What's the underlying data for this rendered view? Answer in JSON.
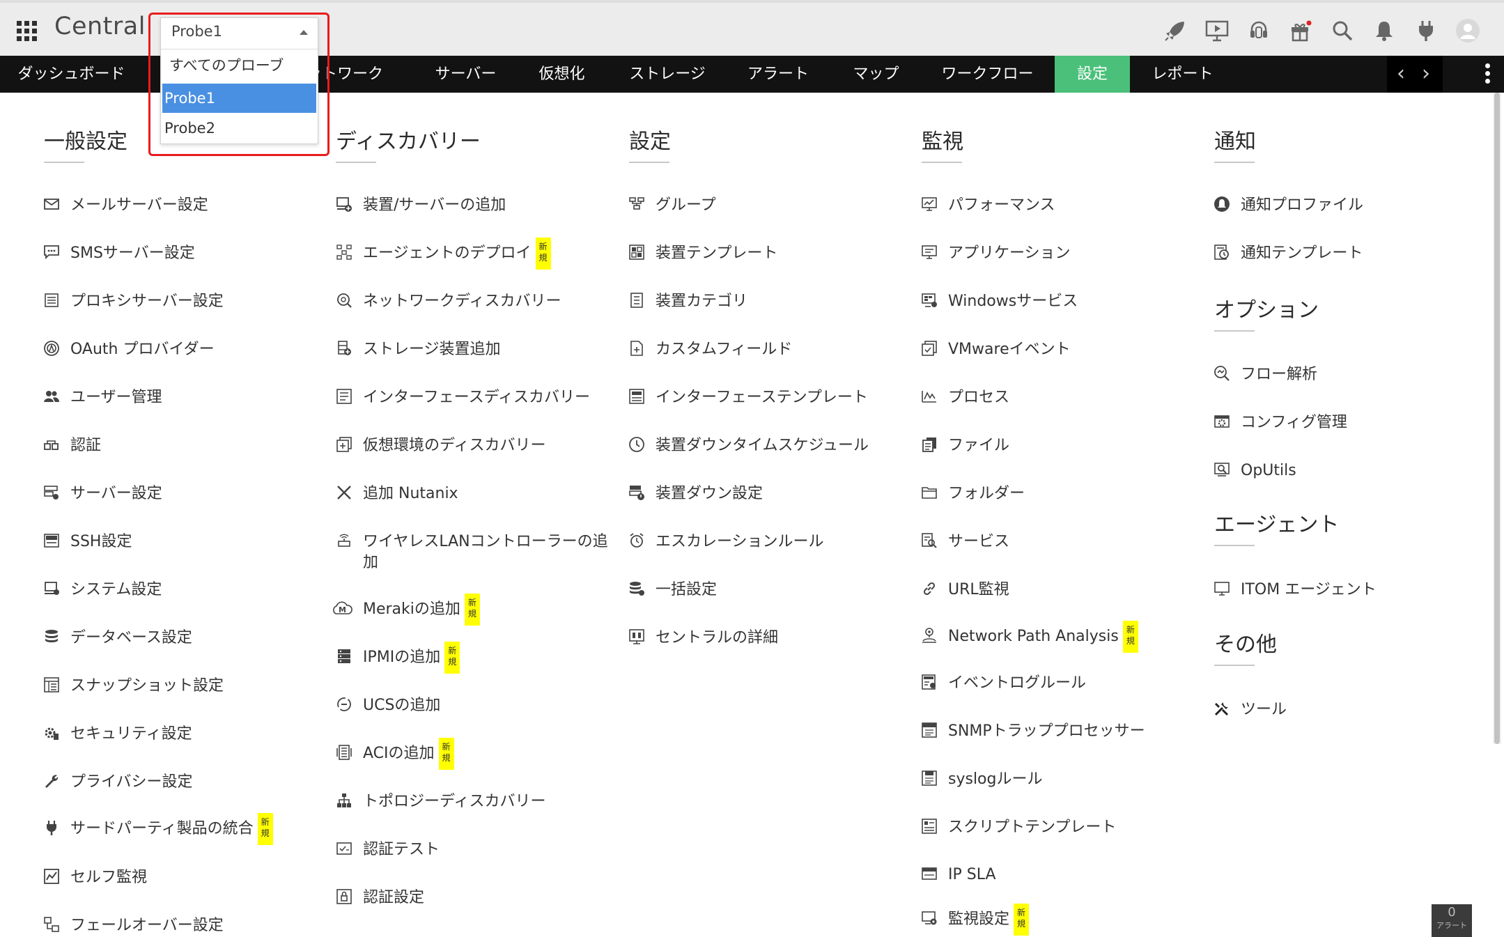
{
  "app": {
    "title": "Central"
  },
  "header_icons": [
    "rocket-icon",
    "presentation-icon",
    "headset-icon",
    "gift-icon",
    "search-icon",
    "bell-icon",
    "plug-icon",
    "user-avatar-icon"
  ],
  "probe_dropdown": {
    "selected": "Probe1",
    "options": [
      "すべてのプローブ",
      "Probe1",
      "Probe2"
    ],
    "highlighted": "Probe1"
  },
  "nav": {
    "items": [
      "ダッシュボード",
      "ネットワーク",
      "サーバー",
      "仮想化",
      "ストレージ",
      "アラート",
      "マップ",
      "ワークフロー",
      "設定",
      "レポート"
    ],
    "visible_partial": "ットワーク",
    "active": "設定"
  },
  "sections": {
    "general": {
      "title": "一般設定",
      "items": [
        {
          "label": "メールサーバー設定",
          "icon": "mail-icon"
        },
        {
          "label": "SMSサーバー設定",
          "icon": "sms-icon"
        },
        {
          "label": "プロキシサーバー設定",
          "icon": "proxy-icon"
        },
        {
          "label": "OAuth プロバイダー",
          "icon": "oauth-icon"
        },
        {
          "label": "ユーザー管理",
          "icon": "users-icon"
        },
        {
          "label": "認証",
          "icon": "key-icon"
        },
        {
          "label": "サーバー設定",
          "icon": "server-settings-icon"
        },
        {
          "label": "SSH設定",
          "icon": "ssh-icon"
        },
        {
          "label": "システム設定",
          "icon": "system-icon"
        },
        {
          "label": "データベース設定",
          "icon": "database-icon"
        },
        {
          "label": "スナップショット設定",
          "icon": "snapshot-icon"
        },
        {
          "label": "セキュリティ設定",
          "icon": "security-gear-icon"
        },
        {
          "label": "プライバシー設定",
          "icon": "wrench-icon"
        },
        {
          "label": "サードパーティ製品の統合",
          "icon": "plug-icon",
          "badge": "新規"
        },
        {
          "label": "セルフ監視",
          "icon": "self-monitor-icon"
        },
        {
          "label": "フェールオーバー設定",
          "icon": "failover-icon"
        }
      ]
    },
    "discovery": {
      "title": "ディスカバリー",
      "items": [
        {
          "label": "装置/サーバーの追加",
          "icon": "add-device-icon"
        },
        {
          "label": "エージェントのデプロイ",
          "icon": "deploy-icon",
          "badge": "新規"
        },
        {
          "label": "ネットワークディスカバリー",
          "icon": "network-discovery-icon"
        },
        {
          "label": "ストレージ装置追加",
          "icon": "storage-add-icon"
        },
        {
          "label": "インターフェースディスカバリー",
          "icon": "interface-discovery-icon"
        },
        {
          "label": "仮想環境のディスカバリー",
          "icon": "virtual-discovery-icon"
        },
        {
          "label": "追加 Nutanix",
          "icon": "nutanix-icon"
        },
        {
          "label": "ワイヤレスLANコントローラーの追",
          "label2": "加",
          "icon": "wireless-icon"
        },
        {
          "label": "Merakiの追加",
          "icon": "meraki-icon",
          "badge": "新規"
        },
        {
          "label": "IPMIの追加",
          "icon": "ipmi-icon",
          "badge": "新規"
        },
        {
          "label": "UCSの追加",
          "icon": "ucs-icon"
        },
        {
          "label": "ACIの追加",
          "icon": "aci-icon",
          "badge": "新規"
        },
        {
          "label": "トポロジーディスカバリー",
          "icon": "topology-icon"
        },
        {
          "label": "認証テスト",
          "icon": "cred-test-icon"
        },
        {
          "label": "認証設定",
          "icon": "lock-icon"
        }
      ]
    },
    "settings": {
      "title": "設定",
      "items": [
        {
          "label": "グループ",
          "icon": "group-icon"
        },
        {
          "label": "装置テンプレート",
          "icon": "device-template-icon"
        },
        {
          "label": "装置カテゴリ",
          "icon": "category-icon"
        },
        {
          "label": "カスタムフィールド",
          "icon": "custom-field-icon"
        },
        {
          "label": "インターフェーステンプレート",
          "icon": "interface-template-icon"
        },
        {
          "label": "装置ダウンタイムスケジュール",
          "icon": "clock-icon"
        },
        {
          "label": "装置ダウン設定",
          "icon": "device-down-icon"
        },
        {
          "label": "エスカレーションルール",
          "icon": "alarm-clock-icon"
        },
        {
          "label": "一括設定",
          "icon": "bulk-icon"
        },
        {
          "label": "セントラルの詳細",
          "icon": "central-details-icon"
        }
      ]
    },
    "monitoring": {
      "title": "監視",
      "items": [
        {
          "label": "パフォーマンス",
          "icon": "performance-icon"
        },
        {
          "label": "アプリケーション",
          "icon": "application-icon"
        },
        {
          "label": "Windowsサービス",
          "icon": "windows-service-icon"
        },
        {
          "label": "VMwareイベント",
          "icon": "vmware-icon"
        },
        {
          "label": "プロセス",
          "icon": "process-icon"
        },
        {
          "label": "ファイル",
          "icon": "file-icon"
        },
        {
          "label": "フォルダー",
          "icon": "folder-icon"
        },
        {
          "label": "サービス",
          "icon": "service-icon"
        },
        {
          "label": "URL監視",
          "icon": "link-icon"
        },
        {
          "label": "Network Path Analysis",
          "icon": "path-icon",
          "badge": "新規"
        },
        {
          "label": "イベントログルール",
          "icon": "eventlog-icon"
        },
        {
          "label": "SNMPトラッププロセッサー",
          "icon": "trap-icon"
        },
        {
          "label": "syslogルール",
          "icon": "syslog-icon"
        },
        {
          "label": "スクリプトテンプレート",
          "icon": "script-icon"
        },
        {
          "label": "IP SLA",
          "icon": "ipsla-icon"
        },
        {
          "label": "監視設定",
          "icon": "monitor-settings-icon",
          "badge": "新規"
        }
      ]
    },
    "notification": {
      "title": "通知",
      "items": [
        {
          "label": "通知プロファイル",
          "icon": "notification-profile-icon"
        },
        {
          "label": "通知テンプレート",
          "icon": "notification-template-icon"
        }
      ]
    },
    "options": {
      "title": "オプション",
      "items": [
        {
          "label": "フロー解析",
          "icon": "flow-icon"
        },
        {
          "label": "コンフィグ管理",
          "icon": "config-icon"
        },
        {
          "label": "OpUtils",
          "icon": "oputils-icon"
        }
      ]
    },
    "agent": {
      "title": "エージェント",
      "items": [
        {
          "label": "ITOM エージェント",
          "icon": "monitor-icon"
        }
      ]
    },
    "other": {
      "title": "その他",
      "items": [
        {
          "label": "ツール",
          "icon": "tools-icon"
        }
      ]
    }
  },
  "alerts": {
    "count": "0",
    "label": "アラート"
  }
}
